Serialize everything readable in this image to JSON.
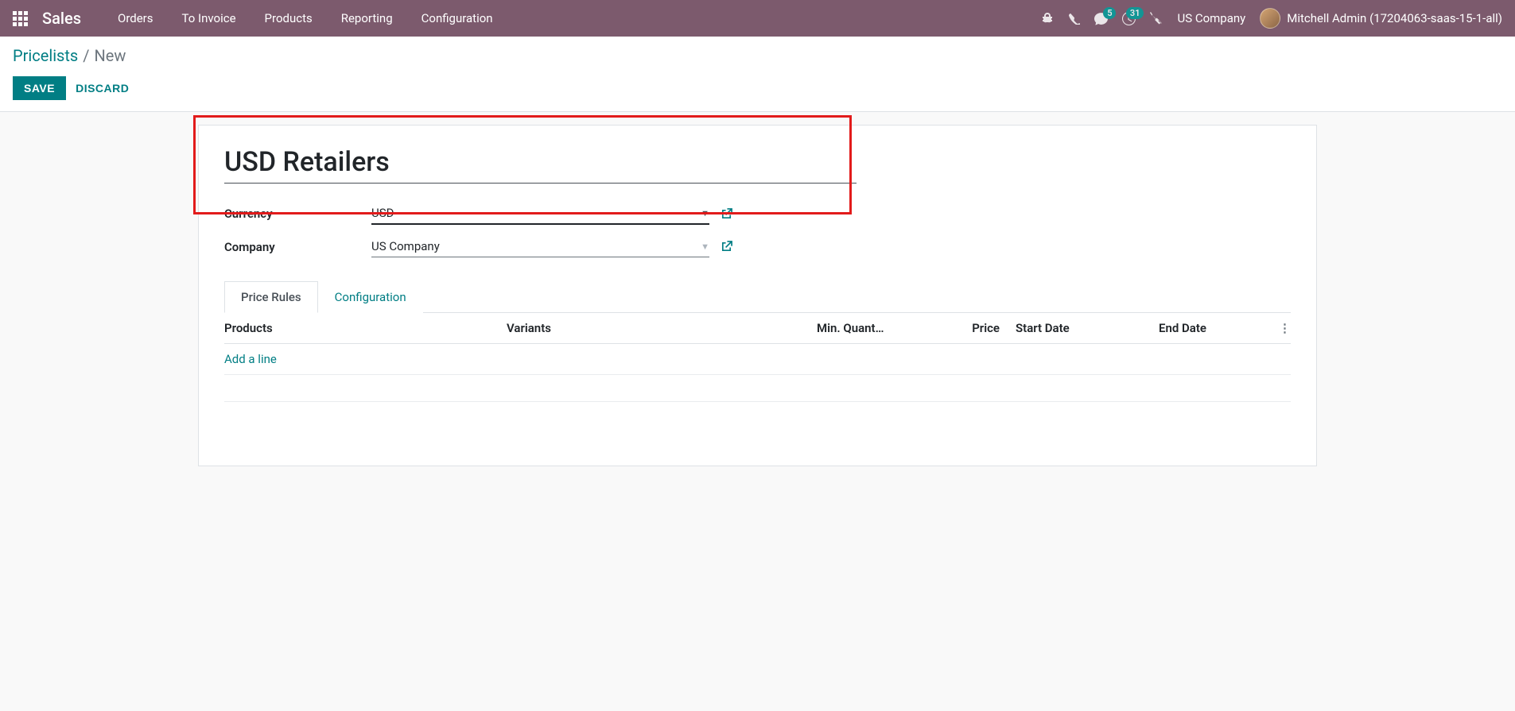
{
  "navbar": {
    "app_title": "Sales",
    "menu": [
      "Orders",
      "To Invoice",
      "Products",
      "Reporting",
      "Configuration"
    ],
    "messaging_badge": "5",
    "activities_badge": "31",
    "company": "US Company",
    "user_name": "Mitchell Admin (17204063-saas-15-1-all)"
  },
  "breadcrumb": {
    "parent": "Pricelists",
    "current": "New"
  },
  "buttons": {
    "save": "SAVE",
    "discard": "DISCARD"
  },
  "form": {
    "name_value": "USD Retailers",
    "currency_label": "Currency",
    "currency_value": "USD",
    "company_label": "Company",
    "company_value": "US Company"
  },
  "tabs": {
    "price_rules": "Price Rules",
    "configuration": "Configuration"
  },
  "table": {
    "headers": {
      "products": "Products",
      "variants": "Variants",
      "min_qty": "Min. Quant…",
      "price": "Price",
      "start_date": "Start Date",
      "end_date": "End Date"
    },
    "add_line": "Add a line"
  }
}
